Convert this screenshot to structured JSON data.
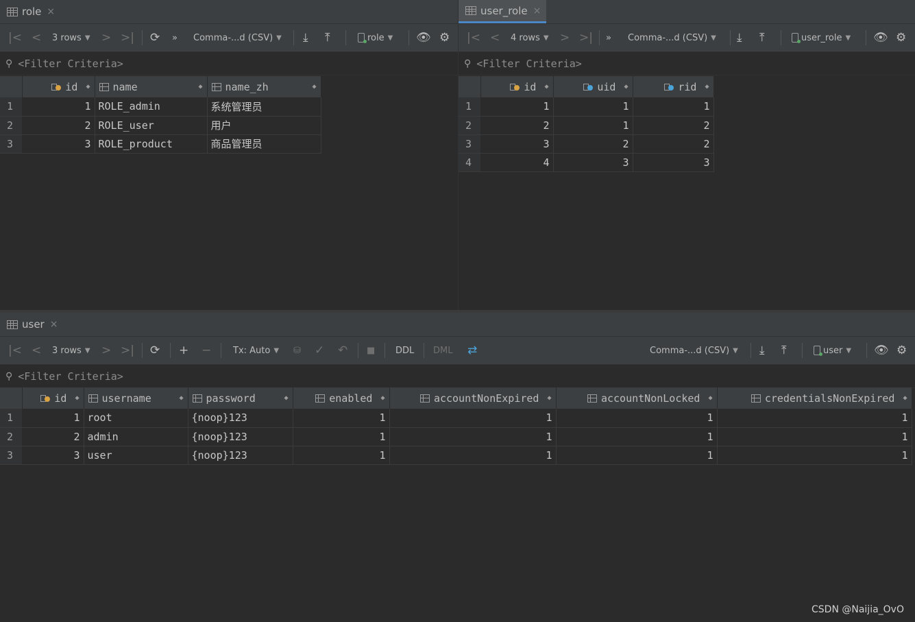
{
  "role_pane": {
    "tab": {
      "name": "role",
      "close": "×"
    },
    "toolbar": {
      "first": "|<",
      "prev": "<",
      "rows": "3 rows",
      "next": ">",
      "last": ">|",
      "refresh": "⟳",
      "more": "»",
      "format": "Comma-...d (CSV)",
      "download": "⤓",
      "upload": "⤒",
      "datasource": "role",
      "view": "👁",
      "settings": "⚙"
    },
    "filter": "<Filter Criteria>",
    "columns": [
      {
        "name": "id",
        "type": "pk"
      },
      {
        "name": "name",
        "type": "col"
      },
      {
        "name": "name_zh",
        "type": "col"
      }
    ],
    "rows": [
      {
        "rn": "1",
        "id": "1",
        "name": "ROLE_admin",
        "name_zh": "系统管理员"
      },
      {
        "rn": "2",
        "id": "2",
        "name": "ROLE_user",
        "name_zh": "用户"
      },
      {
        "rn": "3",
        "id": "3",
        "name": "ROLE_product",
        "name_zh": "商品管理员"
      }
    ]
  },
  "user_role_pane": {
    "tab": {
      "name": "user_role",
      "close": "×"
    },
    "toolbar": {
      "first": "|<",
      "prev": "<",
      "rows": "4 rows",
      "next": ">",
      "last": ">|",
      "more": "»",
      "format": "Comma-...d (CSV)",
      "download": "⤓",
      "upload": "⤒",
      "datasource": "user_role",
      "view": "👁",
      "settings": "⚙"
    },
    "filter": "<Filter Criteria>",
    "columns": [
      {
        "name": "id",
        "type": "pk"
      },
      {
        "name": "uid",
        "type": "fk"
      },
      {
        "name": "rid",
        "type": "fk"
      }
    ],
    "rows": [
      {
        "rn": "1",
        "id": "1",
        "uid": "1",
        "rid": "1"
      },
      {
        "rn": "2",
        "id": "2",
        "uid": "1",
        "rid": "2"
      },
      {
        "rn": "3",
        "id": "3",
        "uid": "2",
        "rid": "2"
      },
      {
        "rn": "4",
        "id": "4",
        "uid": "3",
        "rid": "3"
      }
    ]
  },
  "user_pane": {
    "tab": {
      "name": "user",
      "close": "×"
    },
    "toolbar": {
      "first": "|<",
      "prev": "<",
      "rows": "3 rows",
      "next": ">",
      "last": ">|",
      "refresh": "⟳",
      "add": "+",
      "remove": "−",
      "tx": "Tx: Auto",
      "db": "⛁",
      "commit": "✓",
      "rollback": "↶",
      "stop": "■",
      "ddl": "DDL",
      "dml": "DML",
      "compare": "⇄",
      "format": "Comma-...d (CSV)",
      "download": "⤓",
      "upload": "⤒",
      "datasource": "user",
      "view": "👁",
      "settings": "⚙"
    },
    "filter": "<Filter Criteria>",
    "columns": [
      {
        "name": "id",
        "type": "pk"
      },
      {
        "name": "username",
        "type": "col"
      },
      {
        "name": "password",
        "type": "col"
      },
      {
        "name": "enabled",
        "type": "col"
      },
      {
        "name": "accountNonExpired",
        "type": "col"
      },
      {
        "name": "accountNonLocked",
        "type": "col"
      },
      {
        "name": "credentialsNonExpired",
        "type": "col"
      }
    ],
    "rows": [
      {
        "rn": "1",
        "id": "1",
        "username": "root",
        "password": "{noop}123",
        "enabled": "1",
        "accountNonExpired": "1",
        "accountNonLocked": "1",
        "credentialsNonExpired": "1"
      },
      {
        "rn": "2",
        "id": "2",
        "username": "admin",
        "password": "{noop}123",
        "enabled": "1",
        "accountNonExpired": "1",
        "accountNonLocked": "1",
        "credentialsNonExpired": "1"
      },
      {
        "rn": "3",
        "id": "3",
        "username": "user",
        "password": "{noop}123",
        "enabled": "1",
        "accountNonExpired": "1",
        "accountNonLocked": "1",
        "credentialsNonExpired": "1"
      }
    ]
  },
  "watermark": "CSDN @Naijia_OvO"
}
